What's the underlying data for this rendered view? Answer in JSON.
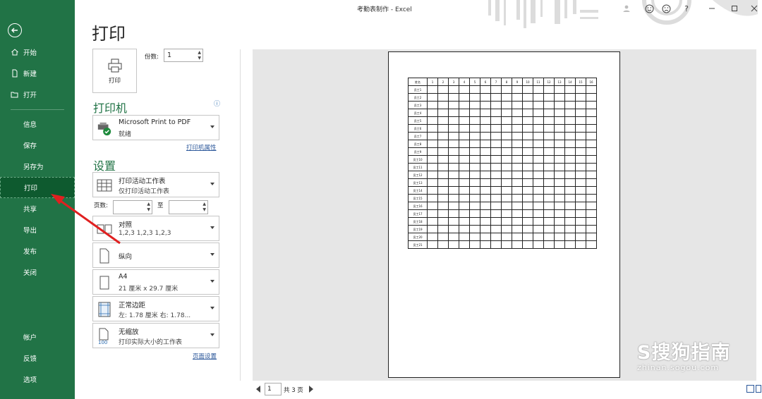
{
  "window": {
    "title": "考勤表制作  -  Excel",
    "controls": [
      "?"
    ]
  },
  "sidebar": {
    "items": [
      {
        "label": "开始",
        "icon": "home-icon"
      },
      {
        "label": "新建",
        "icon": "new-doc-icon"
      },
      {
        "label": "打开",
        "icon": "folder-open-icon"
      },
      {
        "label": "信息"
      },
      {
        "label": "保存"
      },
      {
        "label": "另存为"
      },
      {
        "label": "打印",
        "active": true
      },
      {
        "label": "共享"
      },
      {
        "label": "导出"
      },
      {
        "label": "发布"
      },
      {
        "label": "关闭"
      },
      {
        "label": "帐户"
      },
      {
        "label": "反馈"
      },
      {
        "label": "选项"
      }
    ]
  },
  "print": {
    "heading": "打印",
    "button_label": "打印",
    "copies_label": "份数:",
    "copies_value": "1",
    "printer_section": "打印机",
    "printer_name": "Microsoft Print to PDF",
    "printer_status": "就绪",
    "printer_props_link": "打印机属性",
    "settings_section": "设置",
    "settings": [
      {
        "line1": "打印活动工作表",
        "line2": "仅打印活动工作表"
      },
      {
        "line1": "对照",
        "line2": "1,2,3     1,2,3     1,2,3"
      },
      {
        "line1": "纵向",
        "line2": ""
      },
      {
        "line1": "A4",
        "line2": "21 厘米 x 29.7 厘米"
      },
      {
        "line1": "正常边距",
        "line2": "左: 1.78 厘米    右: 1.78..."
      },
      {
        "line1": "无缩放",
        "line2": "打印实际大小的工作表"
      }
    ],
    "pages_label": "页数:",
    "pages_to": "至",
    "page_setup_link": "页面设置"
  },
  "preview": {
    "header_row": [
      "姓名",
      "1",
      "2",
      "3",
      "4",
      "5",
      "6",
      "7",
      "8",
      "9",
      "10",
      "11",
      "12",
      "13",
      "14",
      "15",
      "16"
    ],
    "rows": [
      "员工1",
      "员工2",
      "员工3",
      "员工4",
      "员工5",
      "员工6",
      "员工7",
      "员工8",
      "员工9",
      "员工10",
      "员工11",
      "员工12",
      "员工13",
      "员工14",
      "员工15",
      "员工16",
      "员工17",
      "员工18",
      "员工19",
      "员工20",
      "员工21"
    ],
    "page_current": "1",
    "page_total": "共 3 页"
  },
  "watermark": {
    "main": "S搜狗指南",
    "sub": "zhinan.sogou.com"
  },
  "colors": {
    "sidebar": "#217346",
    "active": "#0e5a2f",
    "accent": "#217346",
    "link": "#2b579a"
  }
}
